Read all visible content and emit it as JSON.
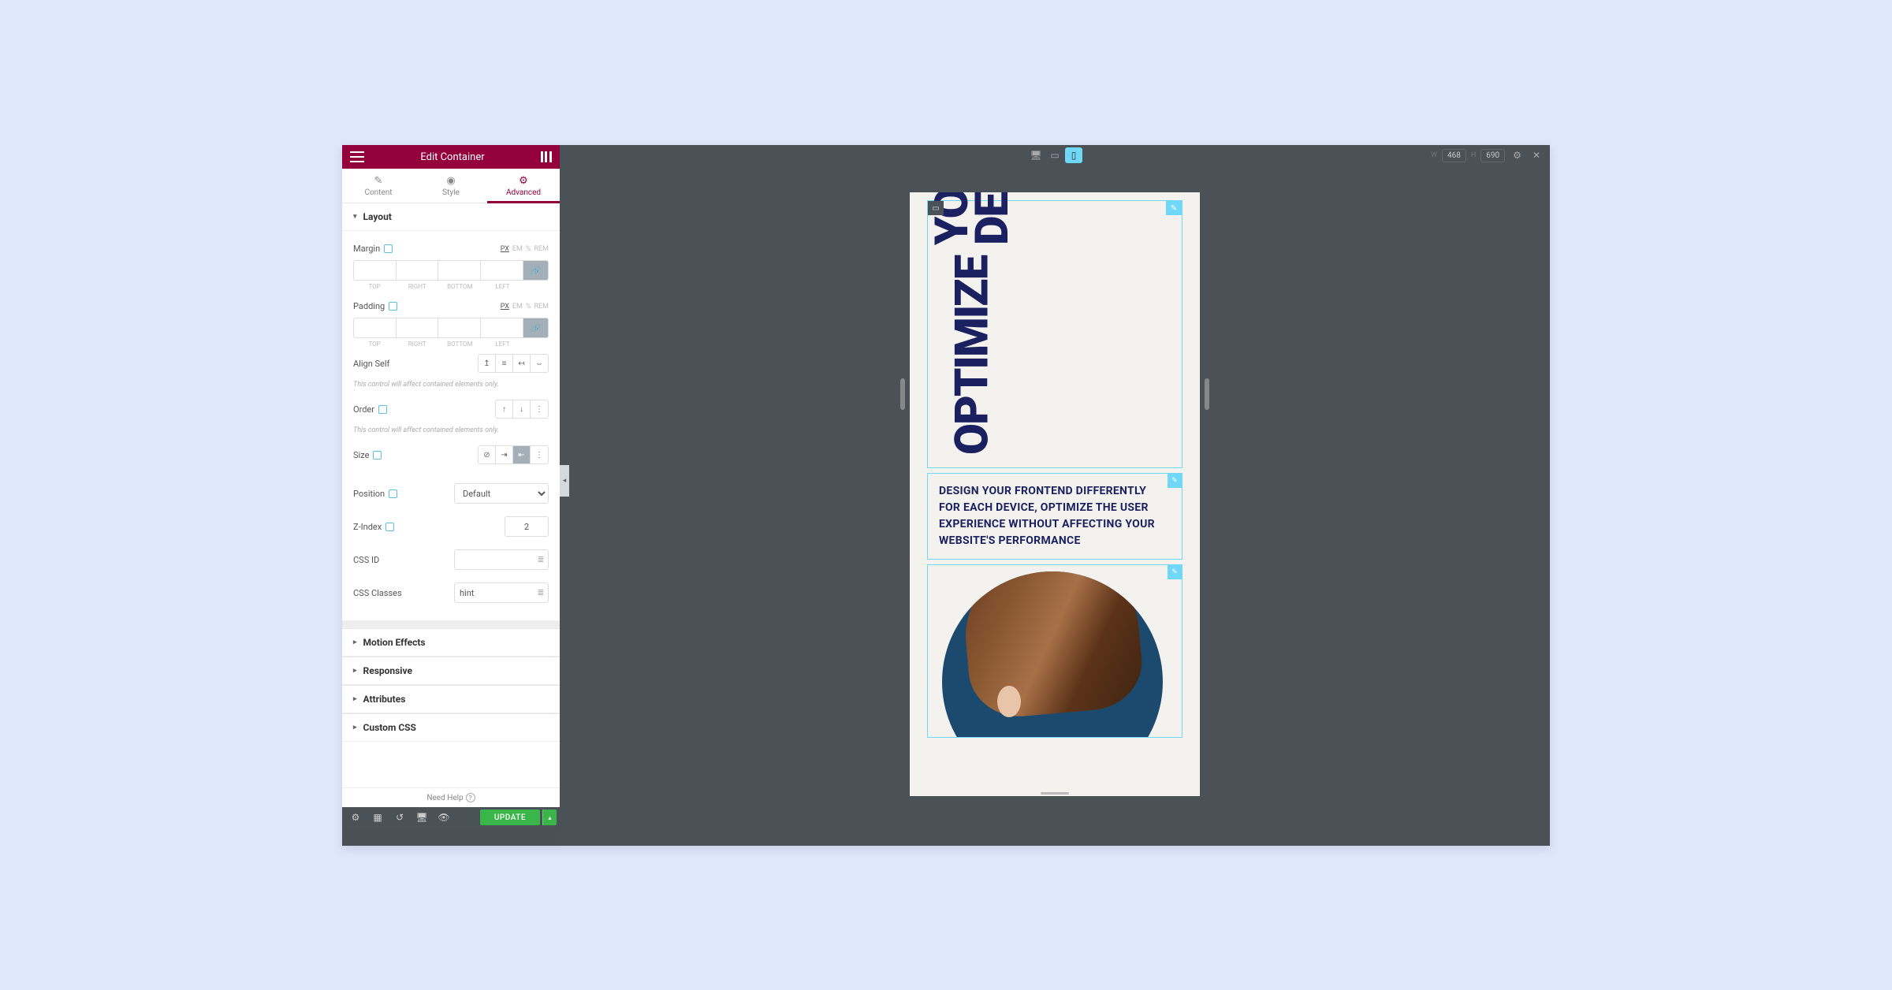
{
  "header": {
    "title": "Edit Container"
  },
  "tabs": {
    "content": "Content",
    "style": "Style",
    "advanced": "Advanced"
  },
  "sections": {
    "layout": "Layout",
    "motion": "Motion Effects",
    "responsive": "Responsive",
    "attributes": "Attributes",
    "customcss": "Custom CSS"
  },
  "controls": {
    "margin": {
      "label": "Margin",
      "units": [
        "PX",
        "EM",
        "%",
        "REM"
      ],
      "sides": [
        "TOP",
        "RIGHT",
        "BOTTOM",
        "LEFT"
      ]
    },
    "padding": {
      "label": "Padding",
      "units": [
        "PX",
        "EM",
        "%",
        "REM"
      ],
      "sides": [
        "TOP",
        "RIGHT",
        "BOTTOM",
        "LEFT"
      ]
    },
    "align_self": {
      "label": "Align Self"
    },
    "help1": "This control will affect contained elements only.",
    "order": {
      "label": "Order"
    },
    "help2": "This control will affect contained elements only.",
    "size": {
      "label": "Size"
    },
    "position": {
      "label": "Position",
      "value": "Default"
    },
    "zindex": {
      "label": "Z-Index",
      "value": "2"
    },
    "cssid": {
      "label": "CSS ID",
      "value": ""
    },
    "cssclasses": {
      "label": "CSS Classes",
      "value": "hint"
    }
  },
  "footer": {
    "need_help": "Need Help",
    "update": "UPDATE"
  },
  "toolbar": {
    "dimensions": {
      "w_label": "W",
      "w": "468",
      "h_label": "H",
      "h": "690"
    }
  },
  "preview": {
    "hero_line1": "OPTIMIZE",
    "hero_line2": "YOUR DESIGN",
    "subtext": "DESIGN YOUR FRONTEND DIFFERENTLY FOR EACH DEVICE, OPTIMIZE THE USER EXPERIENCE WITHOUT AFFECTING YOUR WEBSITE'S PERFORMANCE"
  }
}
